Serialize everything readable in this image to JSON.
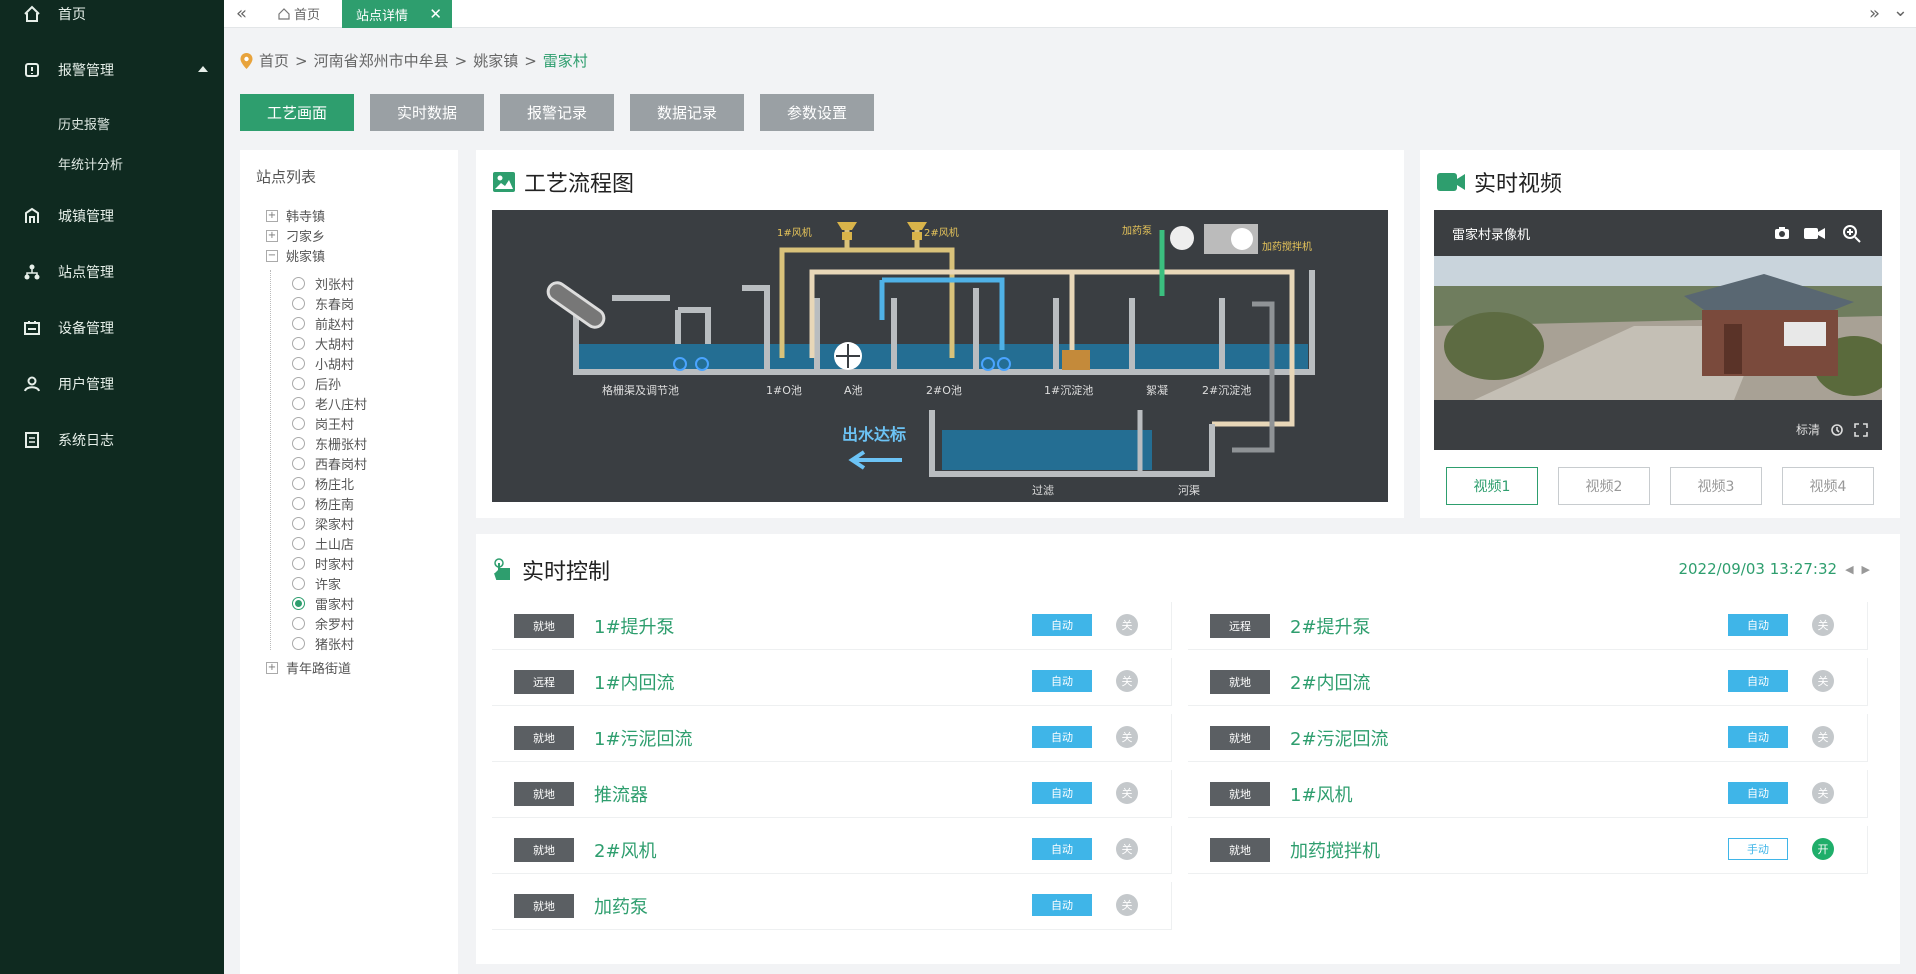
{
  "sidebar": {
    "items": [
      {
        "label": "首页",
        "icon": "home-icon"
      },
      {
        "label": "报警管理",
        "icon": "alarm-icon"
      },
      {
        "label": "城镇管理",
        "icon": "town-icon"
      },
      {
        "label": "站点管理",
        "icon": "site-icon"
      },
      {
        "label": "设备管理",
        "icon": "device-icon"
      },
      {
        "label": "用户管理",
        "icon": "user-icon"
      },
      {
        "label": "系统日志",
        "icon": "log-icon"
      }
    ],
    "subitems": [
      "历史报警",
      "年统计分析"
    ]
  },
  "topbar": {
    "home_tab": "首页",
    "active_tab": "站点详情",
    "close": "✕",
    "left_arrows": "«",
    "right_arrows": "»",
    "down_arrow": "⌄"
  },
  "breadcrumb": [
    "首页",
    "河南省郑州市中牟县",
    "姚家镇",
    "雷家村"
  ],
  "breadcrumb_sep": ">",
  "action_tabs": [
    "工艺画面",
    "实时数据",
    "报警记录",
    "数据记录",
    "参数设置"
  ],
  "tree": {
    "title": "站点列表",
    "top_nodes": [
      {
        "label": "韩寺镇",
        "sign": "+"
      },
      {
        "label": "刁家乡",
        "sign": "+"
      },
      {
        "label": "姚家镇",
        "sign": "−"
      }
    ],
    "leaves": [
      "刘张村",
      "东春岗",
      "前赵村",
      "大胡村",
      "小胡村",
      "后孙",
      "老八庄村",
      "岗王村",
      "东栅张村",
      "西春岗村",
      "杨庄北",
      "杨庄南",
      "梁家村",
      "土山店",
      "时家村",
      "许家",
      "雷家村",
      "余罗村",
      "猪张村"
    ],
    "selected_leaf": "雷家村",
    "last_node": {
      "label": "青年路街道",
      "sign": "+"
    }
  },
  "process": {
    "title": "工艺流程图",
    "labels": {
      "fan1": "1#风机",
      "fan2": "2#风机",
      "dosing_pump": "加药泵",
      "dosing_mixer": "加药搅拌机",
      "grid_tank": "格栅渠及调节池",
      "tank_1o": "1#O池",
      "tank_a": "A池",
      "tank_2o": "2#O池",
      "sed1": "1#沉淀池",
      "coag": "絮凝",
      "sed2": "2#沉淀池",
      "outflow": "出水达标",
      "filter": "过滤",
      "clear": "河渠"
    }
  },
  "video": {
    "title": "实时视频",
    "camera": "雷家村录像机",
    "quality": "标清",
    "buttons": [
      "视频1",
      "视频2",
      "视频3",
      "视频4"
    ]
  },
  "control": {
    "title": "实时控制",
    "datetime": "2022/09/03 13:27:32",
    "left": [
      {
        "mode": "就地",
        "name": "1#提升泵",
        "auto": "自动",
        "state": "关"
      },
      {
        "mode": "远程",
        "name": "1#内回流",
        "auto": "自动",
        "state": "关"
      },
      {
        "mode": "就地",
        "name": "1#污泥回流",
        "auto": "自动",
        "state": "关"
      },
      {
        "mode": "就地",
        "name": "推流器",
        "auto": "自动",
        "state": "关"
      },
      {
        "mode": "就地",
        "name": "2#风机",
        "auto": "自动",
        "state": "关"
      },
      {
        "mode": "就地",
        "name": "加药泵",
        "auto": "自动",
        "state": "关"
      }
    ],
    "right": [
      {
        "mode": "远程",
        "name": "2#提升泵",
        "auto": "自动",
        "state": "关"
      },
      {
        "mode": "就地",
        "name": "2#内回流",
        "auto": "自动",
        "state": "关"
      },
      {
        "mode": "就地",
        "name": "2#污泥回流",
        "auto": "自动",
        "state": "关"
      },
      {
        "mode": "就地",
        "name": "1#风机",
        "auto": "自动",
        "state": "关"
      },
      {
        "mode": "就地",
        "name": "加药搅拌机",
        "auto": "手动",
        "state": "开"
      }
    ]
  },
  "colors": {
    "accent": "#2e9e6e",
    "sidebar": "#0f2a20",
    "blue": "#3fb5e8"
  }
}
